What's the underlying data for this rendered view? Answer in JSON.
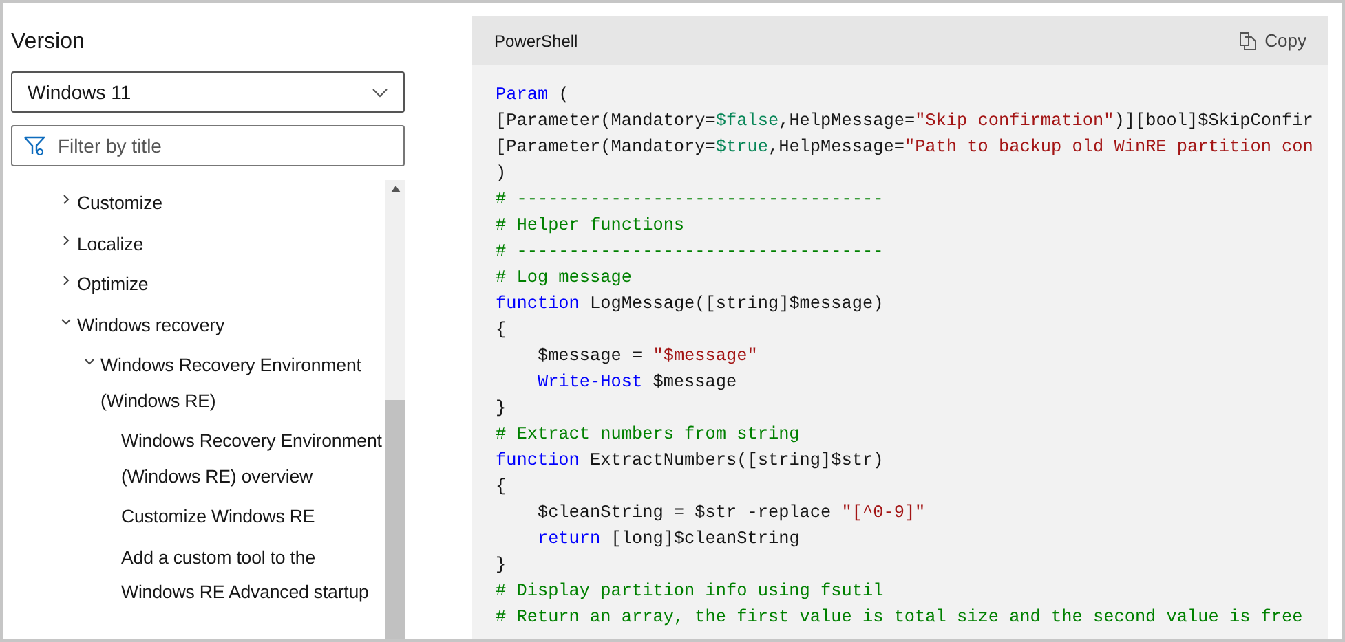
{
  "sidebar": {
    "heading": "Version",
    "version_select": {
      "value": "Windows 11"
    },
    "filter": {
      "placeholder": "Filter by title"
    },
    "tree": [
      {
        "label": "Customize",
        "expanded": false
      },
      {
        "label": "Localize",
        "expanded": false
      },
      {
        "label": "Optimize",
        "expanded": false
      },
      {
        "label": "Windows recovery",
        "expanded": true,
        "children": [
          {
            "label": "Windows Recovery Environment (Windows RE)",
            "expanded": true,
            "children": [
              {
                "label": "Windows Recovery Environment (Windows RE) overview"
              },
              {
                "label": "Customize Windows RE"
              },
              {
                "label": "Add a custom tool to the Windows RE Advanced startup"
              }
            ]
          }
        ]
      }
    ]
  },
  "code_block": {
    "language": "PowerShell",
    "copy_button": "Copy",
    "lines": [
      [
        {
          "kind": "keyword",
          "text": "Param"
        },
        {
          "kind": "plain",
          "text": " ("
        }
      ],
      [
        {
          "kind": "plain",
          "text": "[Parameter(Mandatory="
        },
        {
          "kind": "constant",
          "text": "$false"
        },
        {
          "kind": "plain",
          "text": ",HelpMessage="
        },
        {
          "kind": "string",
          "text": "\"Skip confirmation\""
        },
        {
          "kind": "plain",
          "text": ")][bool]$SkipConfir"
        }
      ],
      [
        {
          "kind": "plain",
          "text": "[Parameter(Mandatory="
        },
        {
          "kind": "constant",
          "text": "$true"
        },
        {
          "kind": "plain",
          "text": ",HelpMessage="
        },
        {
          "kind": "string",
          "text": "\"Path to backup old WinRE partition con"
        }
      ],
      [
        {
          "kind": "plain",
          "text": ")"
        }
      ],
      [
        {
          "kind": "comment",
          "text": "# -----------------------------------"
        }
      ],
      [
        {
          "kind": "comment",
          "text": "# Helper functions"
        }
      ],
      [
        {
          "kind": "comment",
          "text": "# -----------------------------------"
        }
      ],
      [
        {
          "kind": "comment",
          "text": "# Log message"
        }
      ],
      [
        {
          "kind": "keyword",
          "text": "function"
        },
        {
          "kind": "plain",
          "text": " LogMessage([string]$message)"
        }
      ],
      [
        {
          "kind": "plain",
          "text": "{"
        }
      ],
      [
        {
          "kind": "plain",
          "text": "    $message = "
        },
        {
          "kind": "string",
          "text": "\"$message\""
        }
      ],
      [
        {
          "kind": "keyword",
          "text": "    Write-Host"
        },
        {
          "kind": "plain",
          "text": " $message"
        }
      ],
      [
        {
          "kind": "plain",
          "text": "}"
        }
      ],
      [
        {
          "kind": "comment",
          "text": "# Extract numbers from string"
        }
      ],
      [
        {
          "kind": "keyword",
          "text": "function"
        },
        {
          "kind": "plain",
          "text": " ExtractNumbers([string]$str)"
        }
      ],
      [
        {
          "kind": "plain",
          "text": "{"
        }
      ],
      [
        {
          "kind": "plain",
          "text": "    $cleanString = $str -replace "
        },
        {
          "kind": "string",
          "text": "\"[^0-9]\""
        }
      ],
      [
        {
          "kind": "keyword",
          "text": "    return"
        },
        {
          "kind": "plain",
          "text": " [long]$cleanString"
        }
      ],
      [
        {
          "kind": "plain",
          "text": "}"
        }
      ],
      [
        {
          "kind": "comment",
          "text": "# Display partition info using fsutil"
        }
      ],
      [
        {
          "kind": "comment",
          "text": "# Return an array, the first value is total size and the second value is free"
        }
      ]
    ]
  }
}
